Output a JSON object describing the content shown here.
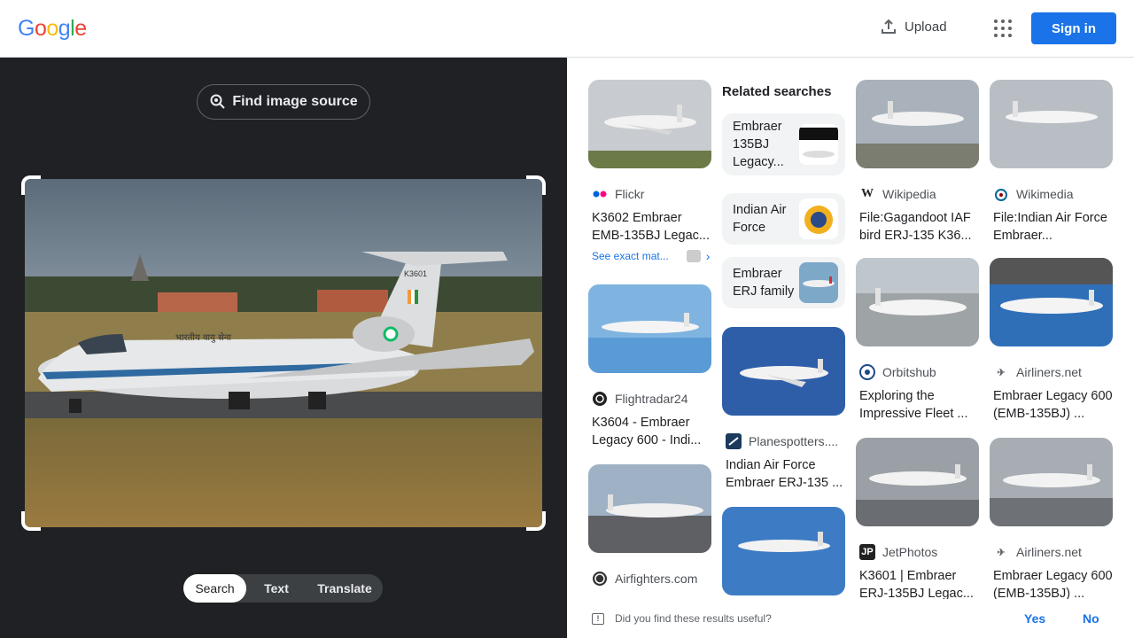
{
  "header": {
    "logo": [
      "G",
      "o",
      "o",
      "g",
      "l",
      "e"
    ],
    "logo_colors": [
      "#4285F4",
      "#EA4335",
      "#FBBC05",
      "#4285F4",
      "#34A853",
      "#EA4335"
    ],
    "upload_label": "Upload",
    "signin_label": "Sign in"
  },
  "left": {
    "find_source_label": "Find image source",
    "photo_tail_text": "K3601",
    "photo_fuselage_text": "भारतीय वायु सेना",
    "tabs": [
      "Search",
      "Text",
      "Translate"
    ],
    "active_tab": "Search"
  },
  "results": [
    {
      "source": "Flickr",
      "title": "K3602 Embraer EMB-135BJ Legac...",
      "icon": "flickr-icon"
    },
    {
      "source": "Flightradar24",
      "title": "K3604 - Embraer Legacy 600 - Indi...",
      "icon": "flightradar-icon"
    },
    {
      "source": "Airfighters.com",
      "title": "",
      "icon": "airfighters-icon"
    },
    {
      "source": "Planespotters....",
      "title": "Indian Air Force Embraer ERJ-135 ...",
      "icon": "planespotters-icon"
    },
    {
      "source": "Wikipedia",
      "title": "File:Gagandoot IAF bird ERJ-135 K36...",
      "icon": "wikipedia-icon"
    },
    {
      "source": "Orbitshub",
      "title": "Exploring the Impressive Fleet ...",
      "icon": "orbitshub-icon"
    },
    {
      "source": "JetPhotos",
      "title": "K3601 | Embraer ERJ-135BJ Legac...",
      "icon": "jetphotos-icon"
    },
    {
      "source": "Wikimedia",
      "title": "File:Indian Air Force Embraer...",
      "icon": "wikimedia-icon"
    },
    {
      "source": "Airliners.net",
      "title": "Embraer Legacy 600 (EMB-135BJ) ...",
      "icon": "airliners-icon"
    },
    {
      "source": "Airliners.net",
      "title": "Embraer Legacy 600 (EMB-135BJ) ...",
      "icon": "airliners-icon"
    }
  ],
  "see_exact_matches": "See exact mat...",
  "related": {
    "heading": "Related searches",
    "items": [
      "Embraer 135BJ Legacy...",
      "Indian Air Force",
      "Embraer ERJ family"
    ]
  },
  "feedback": {
    "question": "Did you find these results useful?",
    "yes": "Yes",
    "no": "No"
  },
  "colors": {
    "accent": "#1a73e8",
    "dark_panel": "#202124"
  }
}
